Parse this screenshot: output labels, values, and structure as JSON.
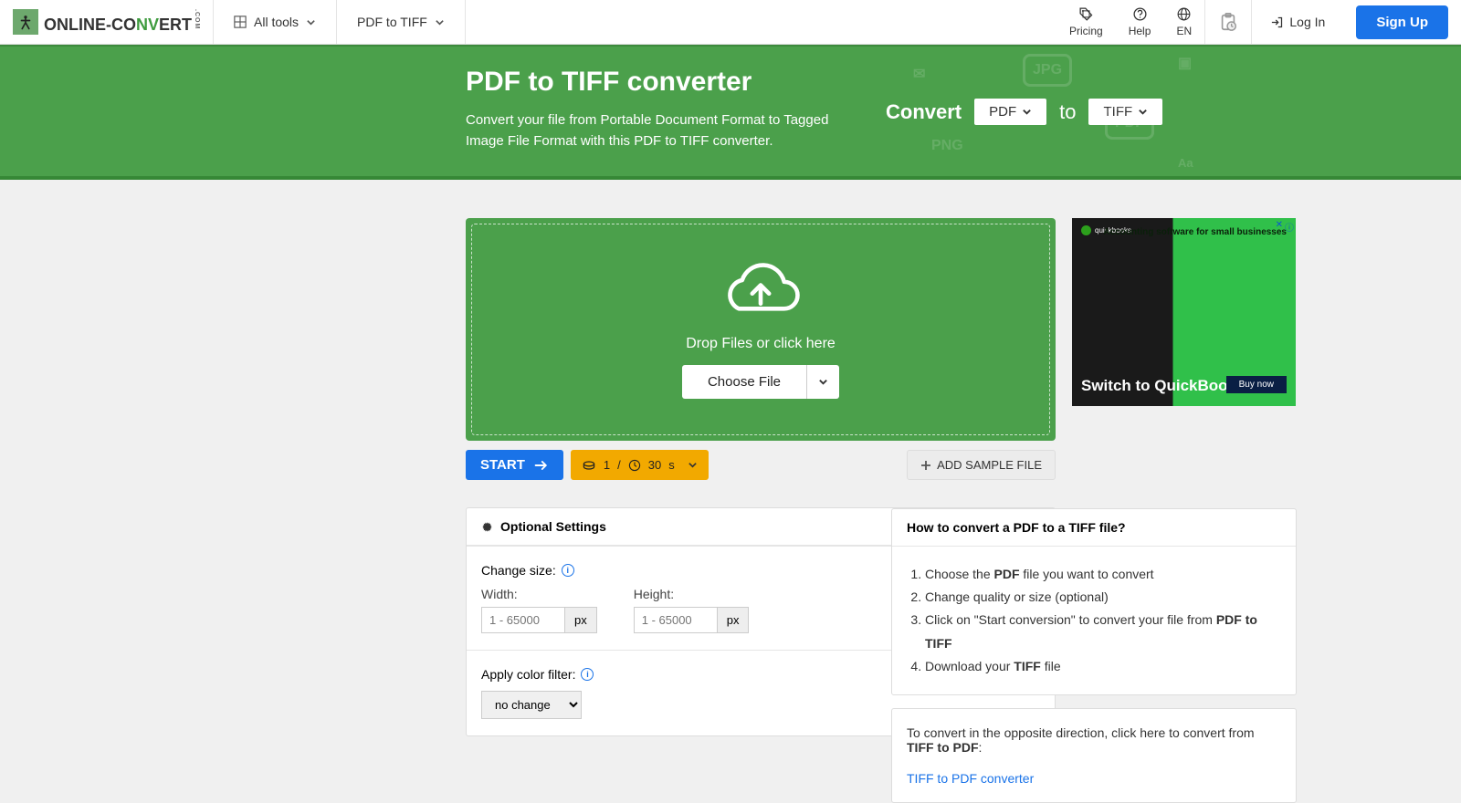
{
  "nav": {
    "all_tools": "All tools",
    "pdf_to_tiff": "PDF to TIFF",
    "pricing": "Pricing",
    "help": "Help",
    "lang": "EN",
    "login": "Log In",
    "signup": "Sign Up"
  },
  "hero": {
    "title": "PDF to TIFF converter",
    "subtitle": "Convert your file from Portable Document Format to Tagged Image File Format with this PDF to TIFF converter.",
    "convert_label": "Convert",
    "from": "PDF",
    "to_label": "to",
    "to": "TIFF"
  },
  "dropzone": {
    "text": "Drop Files or click here",
    "choose": "Choose File"
  },
  "actions": {
    "start": "START",
    "credits": "1",
    "divider": "/",
    "time": "30",
    "unit": "s",
    "add_sample": "ADD SAMPLE FILE"
  },
  "settings": {
    "title": "Optional Settings",
    "change_size": "Change size:",
    "width": "Width:",
    "height": "Height:",
    "placeholder": "1 - 65000",
    "px": "px",
    "apply_filter": "Apply color filter:",
    "filter_value": "no change"
  },
  "howto": {
    "title": "How to convert a PDF to a TIFF file?",
    "step1_pre": "Choose the ",
    "step1_bold": "PDF",
    "step1_post": " file you want to convert",
    "step2": "Change quality or size (optional)",
    "step3_pre": "Click on \"Start conversion\" to convert your file from ",
    "step3_bold": "PDF to TIFF",
    "step4_pre": "Download your ",
    "step4_bold": "TIFF",
    "step4_post": " file"
  },
  "reverse": {
    "text_pre": "To convert in the opposite direction, click here to convert from ",
    "text_bold": "TIFF to PDF",
    "text_post": ":",
    "link": "TIFF to PDF converter"
  },
  "ad": {
    "brand": "quickbooks",
    "tagline": "Accounting software for small businesses",
    "switch": "Switch to QuickBooks.",
    "buy": "Buy now"
  }
}
